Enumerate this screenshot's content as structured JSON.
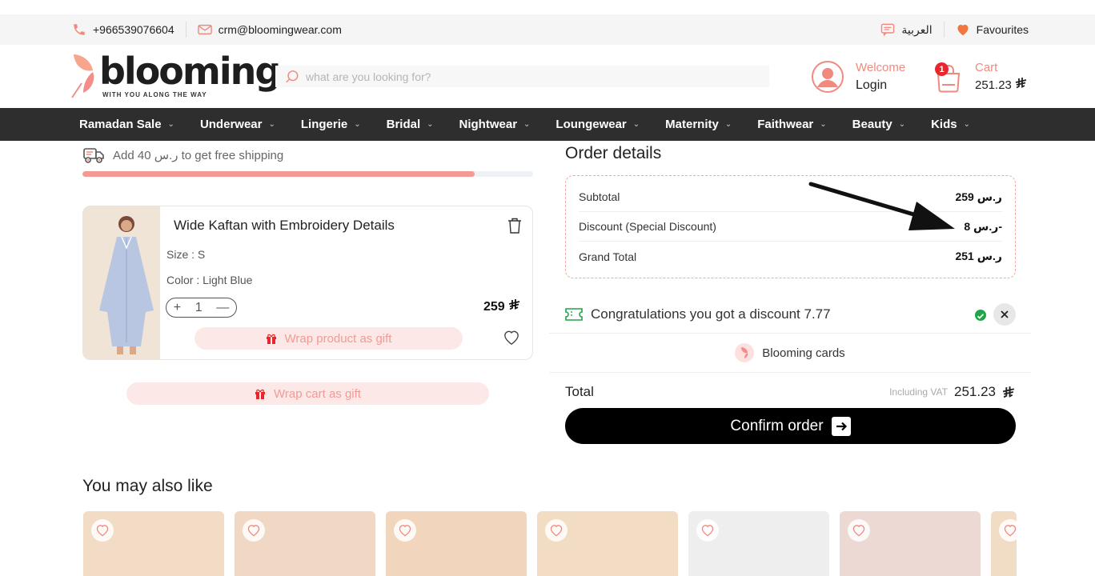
{
  "topbar": {
    "phone": "+966539076604",
    "email": "crm@bloomingwear.com",
    "language": "العربية",
    "favourites": "Favourites"
  },
  "header": {
    "logo_text": "blooming",
    "logo_tagline": "WITH YOU ALONG THE WAY",
    "search_placeholder": "what are you looking for?",
    "welcome": "Welcome",
    "login": "Login",
    "cart_label": "Cart",
    "cart_amount": "251.23",
    "cart_count": "1"
  },
  "nav": [
    "Ramadan Sale",
    "Underwear",
    "Lingerie",
    "Bridal",
    "Nightwear",
    "Loungewear",
    "Maternity",
    "Faithwear",
    "Beauty",
    "Kids"
  ],
  "shipping": {
    "message_prefix": "Add 40",
    "currency": "ر.س",
    "message_suffix": "to get free shipping",
    "progress": 0.87
  },
  "product": {
    "name": "Wide Kaftan with Embroidery Details",
    "size": "Size : S",
    "color": "Color : Light Blue",
    "quantity": "1",
    "price": "259",
    "gift_label": "Wrap product as gift"
  },
  "cart_gift_label": "Wrap cart as gift",
  "order": {
    "title": "Order details",
    "rows": [
      {
        "label": "Subtotal",
        "value": "ر.س 259"
      },
      {
        "label": "Discount (Special Discount)",
        "value": "ر.س 8-"
      },
      {
        "label": "Grand Total",
        "value": "ر.س 251"
      }
    ],
    "discount_message": "Congratulations you got a discount 7.77",
    "blooming_cards": "Blooming cards",
    "total_label": "Total",
    "vat_label": "Including VAT",
    "total_amount": "251.23",
    "confirm_label": "Confirm order"
  },
  "recommendations": {
    "title": "You may also like",
    "tiles": [
      {
        "color": "#f3dcc6"
      },
      {
        "color": "#f0d8c4"
      },
      {
        "color": "#f1d6bd"
      },
      {
        "color": "#f2dcc4"
      },
      {
        "color": "#eeeeee"
      },
      {
        "color": "#ecd9d4"
      },
      {
        "color": "#f1dcc6"
      }
    ]
  },
  "colors": {
    "accent": "#f29a93",
    "nav_bg": "#2e2e2e",
    "confirm_bg": "#000000"
  }
}
